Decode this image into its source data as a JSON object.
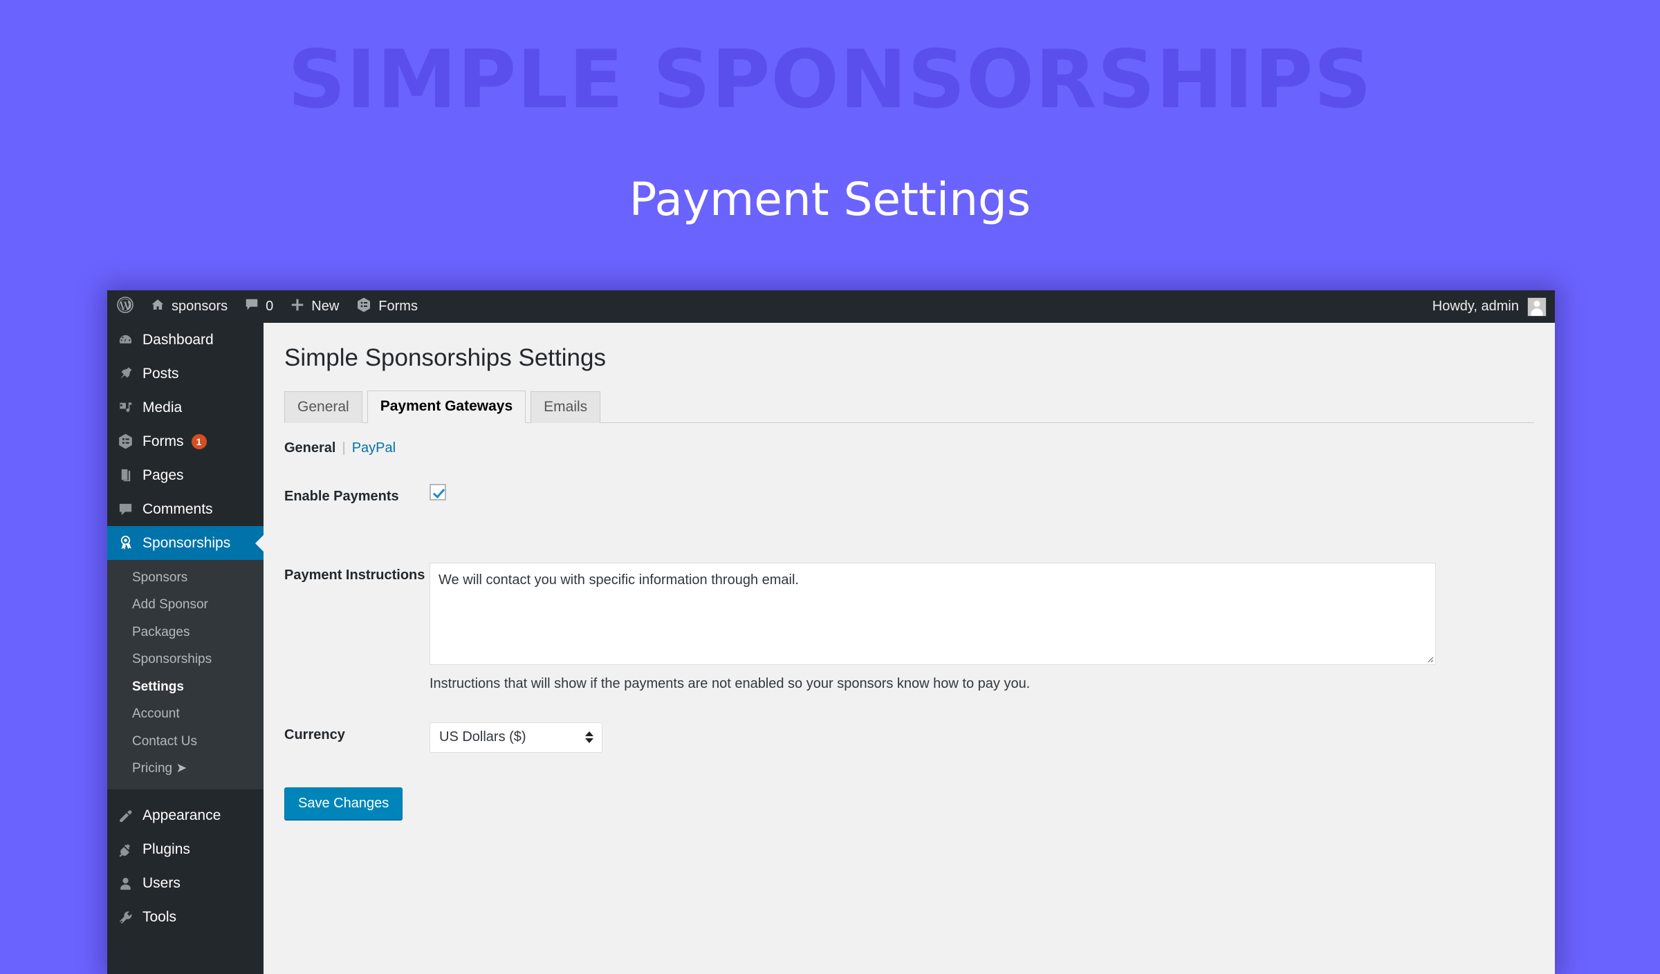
{
  "promo": {
    "background_title": "SIMPLE SPONSORSHIPS",
    "subtitle": "Payment Settings",
    "bg_color": "#6b63fd",
    "bg_title_color": "rgba(62,48,210,0.38)"
  },
  "adminbar": {
    "wp_logo_icon": "wordpress-logo-icon",
    "home_icon": "home-icon",
    "site_name": "sponsors",
    "comments_icon": "comment-bubble-icon",
    "comments_count": "0",
    "new_icon": "plus-icon",
    "new_label": "New",
    "forms_icon": "forms-icon",
    "forms_label": "Forms",
    "howdy": "Howdy, admin",
    "avatar_icon": "avatar-icon"
  },
  "sidebar": {
    "items": [
      {
        "label": "Dashboard",
        "icon": "dashboard-icon",
        "badge": null,
        "active": false
      },
      {
        "label": "Posts",
        "icon": "pin-icon",
        "badge": null,
        "active": false
      },
      {
        "label": "Media",
        "icon": "media-icon",
        "badge": null,
        "active": false
      },
      {
        "label": "Forms",
        "icon": "forms-icon",
        "badge": "1",
        "active": false
      },
      {
        "label": "Pages",
        "icon": "pages-icon",
        "badge": null,
        "active": false
      },
      {
        "label": "Comments",
        "icon": "comment-bubble-icon",
        "badge": null,
        "active": false
      },
      {
        "label": "Sponsorships",
        "icon": "award-ribbon-icon",
        "badge": null,
        "active": true
      }
    ],
    "submenu": [
      {
        "label": "Sponsors",
        "current": false
      },
      {
        "label": "Add Sponsor",
        "current": false
      },
      {
        "label": "Packages",
        "current": false
      },
      {
        "label": "Sponsorships",
        "current": false
      },
      {
        "label": "Settings",
        "current": true
      },
      {
        "label": "Account",
        "current": false
      },
      {
        "label": "Contact Us",
        "current": false
      },
      {
        "label": "Pricing  ➤",
        "current": false
      }
    ],
    "items_bottom": [
      {
        "label": "Appearance",
        "icon": "paintbrush-icon"
      },
      {
        "label": "Plugins",
        "icon": "plug-icon"
      },
      {
        "label": "Users",
        "icon": "user-icon"
      },
      {
        "label": "Tools",
        "icon": "wrench-icon"
      }
    ],
    "active_color": "#0073aa",
    "badge_color": "#d54e21"
  },
  "main": {
    "page_title": "Simple Sponsorships Settings",
    "tabs": [
      {
        "label": "General",
        "active": false
      },
      {
        "label": "Payment Gateways",
        "active": true
      },
      {
        "label": "Emails",
        "active": false
      }
    ],
    "subnav": {
      "current": "General",
      "separator": "|",
      "link": "PayPal"
    },
    "fields": {
      "enable_payments": {
        "label": "Enable Payments",
        "checked": true
      },
      "payment_instructions": {
        "label": "Payment Instructions",
        "value": "We will contact you with specific information through email.",
        "placeholder": "",
        "description": "Instructions that will show if the payments are not enabled so your sponsors know how to pay you."
      },
      "currency": {
        "label": "Currency",
        "selected": "US Dollars ($)"
      }
    },
    "save_button": "Save Changes"
  }
}
